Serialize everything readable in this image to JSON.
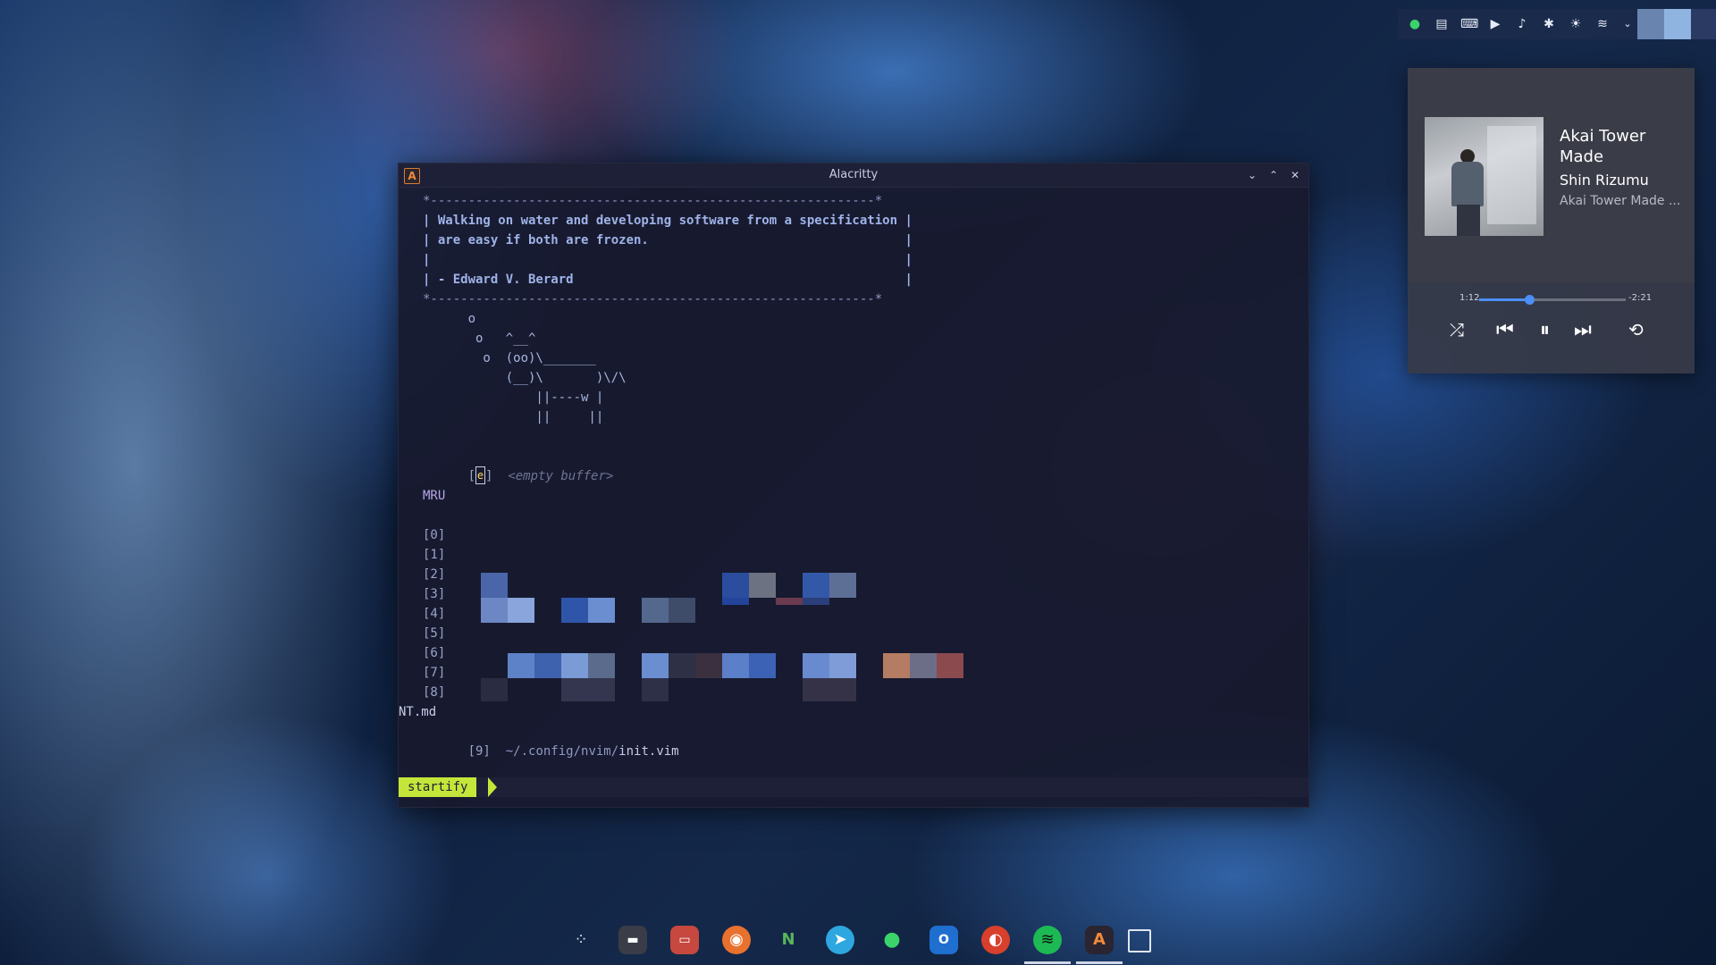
{
  "window": {
    "title": "Alacritty",
    "app_icon": "A",
    "controls": {
      "minimize": "⌄",
      "maximize": "⌃",
      "close": "✕"
    }
  },
  "terminal": {
    "quote_box": {
      "border_top": "*-----------------------------------------------------------*",
      "line1": "| Walking on water and developing software from a specification |",
      "line2": "| are easy if both are frozen.                                  |",
      "line3": "|                                                               |",
      "line4": "| - Edward V. Berard                                            |",
      "border_bottom": "*-----------------------------------------------------------*"
    },
    "cowsay": [
      "      o",
      "       o   ^__^",
      "        o  (oo)\\_______",
      "           (__)\\       )\\/\\",
      "               ||----w |",
      "               ||     ||"
    ],
    "buffer": {
      "bracket_open": "[",
      "key": "e",
      "bracket_close": "]",
      "label": "<empty buffer>"
    },
    "mru_header": "MRU",
    "mru_indices": [
      "[0]",
      "[1]",
      "[2]",
      "[3]",
      "[4]",
      "[5]",
      "[6]",
      "[7]",
      "[8]"
    ],
    "wrapped_text": "NT.md",
    "last_item": {
      "index": "[9]",
      "dir": "~/.config/nvim/",
      "file": "init.vim"
    },
    "status_mode": "startify"
  },
  "tray": {
    "icons": [
      "wechat-icon",
      "clipboard-icon",
      "keyboard-icon",
      "play-circle-icon",
      "volume-icon",
      "bluetooth-icon",
      "brightness-icon",
      "wifi-icon",
      "chevron-down-icon"
    ]
  },
  "media": {
    "title": "Akai Tower Made",
    "artist": "Shin Rizumu",
    "album": "Akai Tower Made ...",
    "elapsed": "1:12",
    "remaining": "-2:21",
    "progress_fraction": 0.34,
    "accent": "#4c8ff5"
  },
  "dock": {
    "apps": [
      "launcher-icon",
      "terminal-icon",
      "file-manager-icon",
      "firefox-icon",
      "neovim-icon",
      "telegram-icon",
      "wechat-icon",
      "outlook-icon",
      "record-icon",
      "spotify-icon",
      "alacritty-icon",
      "show-desktop-icon"
    ]
  }
}
